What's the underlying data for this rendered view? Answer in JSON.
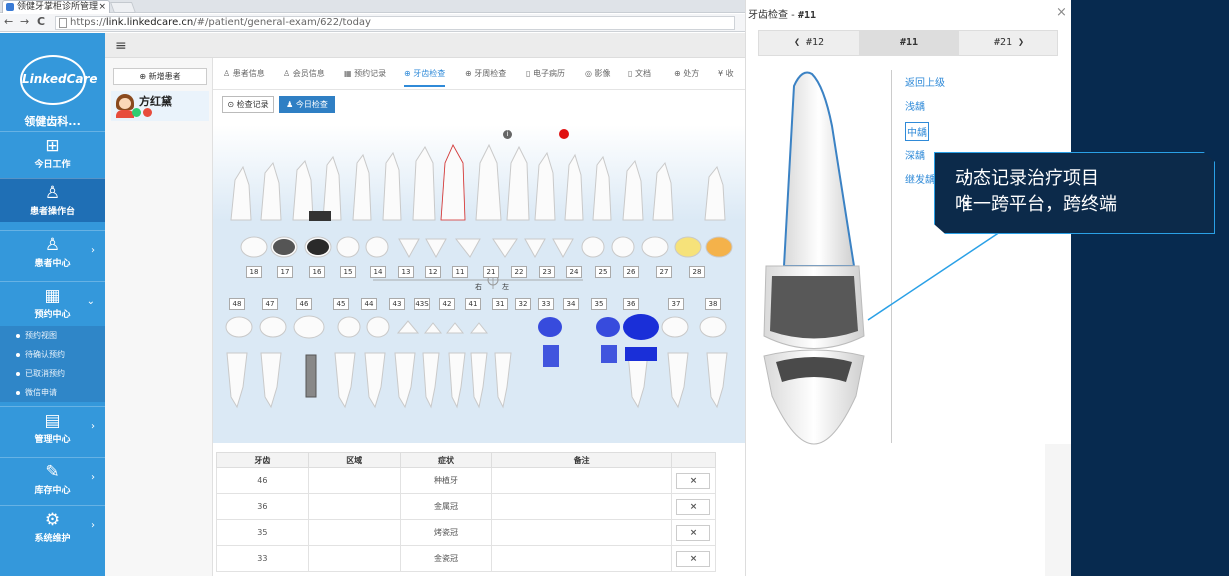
{
  "browser": {
    "tab_title": "领健牙掌柜诊所管理",
    "tab_close": "×",
    "nav_back": "←",
    "nav_forward": "→",
    "nav_reload": "C",
    "url_prefix": "https://",
    "url_host": "link.linkedcare.cn",
    "url_path": "/#/patient/general-exam/622/today"
  },
  "sidebar": {
    "logo_text": "LinkedCare",
    "clinic_name": "领健齿科...",
    "items": [
      {
        "icon": "grid-icon",
        "glyph": "⊞",
        "label": "今日工作"
      },
      {
        "icon": "user-icon",
        "glyph": "♙",
        "label": "患者操作台"
      },
      {
        "icon": "users-icon",
        "glyph": "♙",
        "label": "患者中心",
        "arrow": "›"
      },
      {
        "icon": "calendar-icon",
        "glyph": "▦",
        "label": "预约中心",
        "arrow": "⌄"
      },
      {
        "icon": "book-icon",
        "glyph": "▤",
        "label": "管理中心",
        "arrow": "›"
      },
      {
        "icon": "edit-icon",
        "glyph": "✎",
        "label": "库存中心",
        "arrow": "›"
      },
      {
        "icon": "gear-icon",
        "glyph": "⚙",
        "label": "系统维护",
        "arrow": "›"
      }
    ],
    "subitems": [
      "预约视图",
      "待确认预约",
      "已取消预约",
      "微信申请"
    ]
  },
  "toolbar": {
    "menu_glyph": "≡"
  },
  "patient_list": {
    "new_patient": "⊕ 新增患者",
    "patient_name": "方红黛"
  },
  "main_tabs": [
    {
      "label": "♙ 患者信息"
    },
    {
      "label": "♙ 会员信息"
    },
    {
      "label": "▦ 预约记录"
    },
    {
      "label": "⊕ 牙齿检查",
      "selected": true
    },
    {
      "label": "⊕ 牙周检查"
    },
    {
      "label": "▯ 电子病历"
    },
    {
      "label": "◎ 影像"
    },
    {
      "label": "▯ 文档"
    },
    {
      "label": "⊕ 处方"
    },
    {
      "label": "¥ 收"
    }
  ],
  "buttons": {
    "exam_record": "⊙ 检查记录",
    "today_exam": "♟ 今日检查"
  },
  "tooth_chart": {
    "info_mark": "i",
    "upper_numbers": [
      "18",
      "17",
      "16",
      "15",
      "14",
      "13",
      "12",
      "11",
      "21",
      "22",
      "23",
      "24",
      "25",
      "26",
      "27",
      "28"
    ],
    "lower_numbers": [
      "48",
      "47",
      "46",
      "45",
      "44",
      "43",
      "43S",
      "42",
      "41",
      "31",
      "32",
      "33",
      "34",
      "35",
      "36",
      "37",
      "38"
    ],
    "right_label": "右",
    "left_label": "左"
  },
  "findings_table": {
    "headers": [
      "牙齿",
      "区域",
      "症状",
      "备注",
      ""
    ],
    "rows": [
      {
        "tooth": "46",
        "area": "",
        "symptom": "种植牙",
        "note": "",
        "action": "×"
      },
      {
        "tooth": "36",
        "area": "",
        "symptom": "金属冠",
        "note": "",
        "action": "×"
      },
      {
        "tooth": "35",
        "area": "",
        "symptom": "烤瓷冠",
        "note": "",
        "action": "×"
      },
      {
        "tooth": "33",
        "area": "",
        "symptom": "金瓷冠",
        "note": "",
        "action": "×"
      }
    ]
  },
  "panel": {
    "title_prefix": "牙齿检查 - ",
    "title_tooth": "#11",
    "close": "×",
    "tabs": [
      {
        "label": "❮ #12"
      },
      {
        "label": "#11",
        "selected": true
      },
      {
        "label": "#21 ❯"
      }
    ],
    "back": "返回上级",
    "depths": [
      {
        "label": "浅龋"
      },
      {
        "label": "中龋",
        "selected": true
      },
      {
        "label": "深龋"
      },
      {
        "label": "继发龋"
      }
    ]
  },
  "callout": {
    "bullets": [
      "动态记录治疗项目",
      "唯一跨平台，跨终端"
    ]
  },
  "colors": {
    "sidebar": "#3498db",
    "sidebar_active": "#1f6fb5",
    "accent": "#2f8ad8",
    "filled_tooth": "#1a2fd8",
    "callout_bg": "#0c2a4a"
  }
}
